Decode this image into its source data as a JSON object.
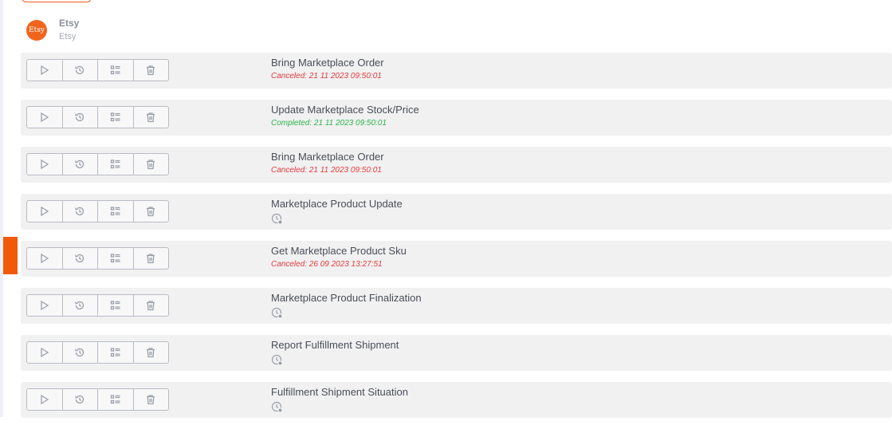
{
  "colors": {
    "brand": "#f1641e",
    "canceled": "#e53b3b",
    "completed": "#2cb34a",
    "selected_marker": "#f15a0a"
  },
  "header": {
    "logo_text": "Etsy",
    "name": "Etsy",
    "subtitle": "Etsy"
  },
  "row_actions": [
    "play-icon",
    "history-icon",
    "list-details-icon",
    "trash-icon"
  ],
  "tasks": [
    {
      "title": "Bring Marketplace Order",
      "status": "canceled",
      "status_text": "Canceled: 21 11 2023 09:50:01"
    },
    {
      "title": "Update Marketplace Stock/Price",
      "status": "completed",
      "status_text": "Completed: 21 11 2023 09:50:01"
    },
    {
      "title": "Bring Marketplace Order",
      "status": "canceled",
      "status_text": "Canceled: 21 11 2023 09:50:01"
    },
    {
      "title": "Marketplace Product Update",
      "status": "pending",
      "status_text": ""
    },
    {
      "title": "Get Marketplace Product Sku",
      "status": "canceled",
      "status_text": "Canceled: 26 09 2023 13:27:51"
    },
    {
      "title": "Marketplace Product Finalization",
      "status": "pending",
      "status_text": ""
    },
    {
      "title": "Report Fulfillment Shipment",
      "status": "pending",
      "status_text": ""
    },
    {
      "title": "Fulfillment Shipment Situation",
      "status": "pending",
      "status_text": ""
    }
  ]
}
